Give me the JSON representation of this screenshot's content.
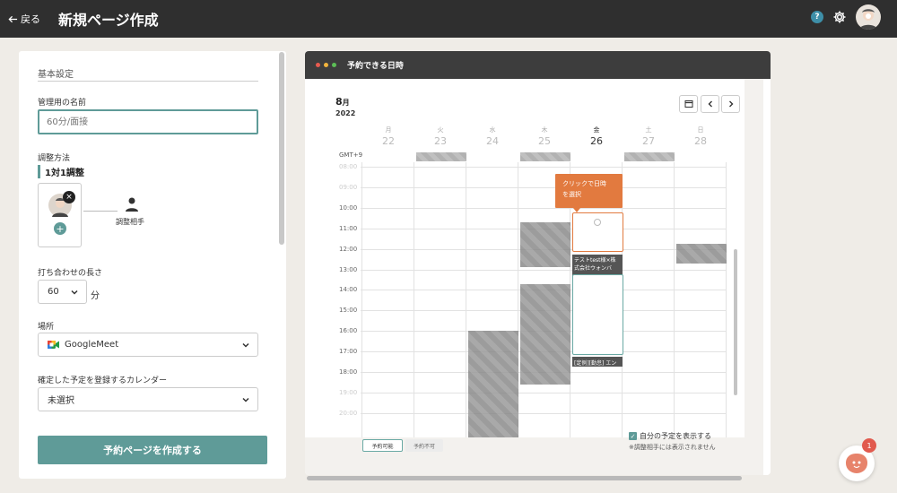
{
  "header": {
    "back_label": "戻る",
    "title": "新規ページ作成",
    "help_glyph": "?"
  },
  "form": {
    "section_title": "基本設定",
    "name_label": "管理用の名前",
    "name_placeholder": "60分/面接",
    "method_label": "調整方法",
    "method_value": "1対1調整",
    "remove_glyph": "×",
    "add_glyph": "+",
    "partner_label": "調整相手",
    "duration_label": "打ち合わせの長さ",
    "duration_value": "60",
    "duration_unit": "分",
    "location_label": "場所",
    "location_value": "GoogleMeet",
    "calendar_label": "確定した予定を登録するカレンダー",
    "calendar_value": "未選択",
    "create_button": "予約ページを作成する"
  },
  "preview": {
    "title": "予約できる日時",
    "dot_colors": [
      "#e85b4f",
      "#f1b43c",
      "#5cbf56"
    ],
    "month": "8",
    "month_unit": "月",
    "year": "2022",
    "days": [
      {
        "weekday": "月",
        "date": "22",
        "today": false
      },
      {
        "weekday": "火",
        "date": "23",
        "today": false
      },
      {
        "weekday": "水",
        "date": "24",
        "today": false
      },
      {
        "weekday": "木",
        "date": "25",
        "today": false
      },
      {
        "weekday": "金",
        "date": "26",
        "today": true
      },
      {
        "weekday": "土",
        "date": "27",
        "today": false
      },
      {
        "weekday": "日",
        "date": "28",
        "today": false
      }
    ],
    "timezone": "GMT+9",
    "hours": [
      "08:00",
      "09:00",
      "10:00",
      "11:00",
      "12:00",
      "13:00",
      "14:00",
      "15:00",
      "16:00",
      "17:00",
      "18:00",
      "19:00",
      "20:00"
    ],
    "tooltip_line1": "クリックで日時",
    "tooltip_line2": "を選択",
    "pending_event_1_line1": "テストtest様×株",
    "pending_event_1_line2": "式会社ウォンバ",
    "pending_event_2": "[定例][勤怠] エン",
    "legend_available": "予約可能",
    "legend_unavailable": "予約不可",
    "show_own_label": "自分の予定を表示する",
    "show_own_note": "※調整相手には表示されません",
    "check_glyph": "✓"
  },
  "chat": {
    "badge_count": "1"
  },
  "colors": {
    "accent": "#5f9b98",
    "header": "#2f2f2f",
    "tooltip": "#e27a3f"
  }
}
